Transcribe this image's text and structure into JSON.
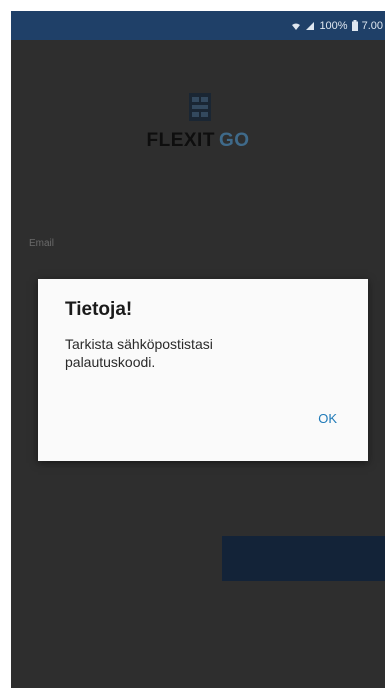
{
  "status_bar": {
    "battery_percent": "100%",
    "time": "7.00",
    "icons": [
      "wifi-icon",
      "signal-icon",
      "battery-icon"
    ]
  },
  "logo": {
    "brand": "FLEXIT",
    "suffix": "GO"
  },
  "form": {
    "field_label": "Email"
  },
  "dialog": {
    "title": "Tietoja!",
    "message": "Tarkista sähköpostistasi palautuskoodi.",
    "ok_label": "OK"
  },
  "colors": {
    "status_bar": "#1f4068",
    "background": "#2e2e2e",
    "dialog": "#fafafa",
    "accent": "#1f7ab8",
    "button": "#132338"
  }
}
